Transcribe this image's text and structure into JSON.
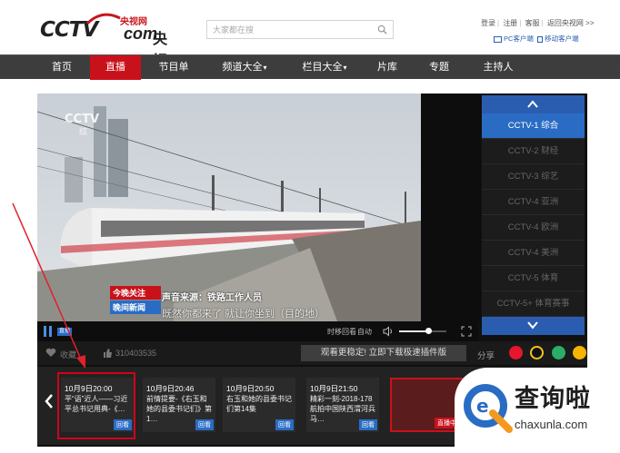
{
  "header": {
    "logo": {
      "brand": "CCTV",
      "small_cn": "央视网",
      "com": "com",
      "cn": "央视"
    },
    "search": {
      "placeholder": "大家都在搜"
    },
    "top_links": [
      "登录",
      "注册",
      "客服",
      "返回央视网 >>"
    ],
    "sub_links": [
      "PC客户端",
      "移动客户端"
    ]
  },
  "nav": {
    "items": [
      {
        "label": "首页",
        "active": false,
        "dropdown": false
      },
      {
        "label": "直播",
        "active": true,
        "dropdown": false
      },
      {
        "label": "节目单",
        "active": false,
        "dropdown": false
      },
      {
        "label": "频道大全",
        "active": false,
        "dropdown": true
      },
      {
        "label": "栏目大全",
        "active": false,
        "dropdown": true
      },
      {
        "label": "片库",
        "active": false,
        "dropdown": false
      },
      {
        "label": "专题",
        "active": false,
        "dropdown": false
      },
      {
        "label": "主持人",
        "active": false,
        "dropdown": false
      }
    ]
  },
  "player": {
    "overlay": {
      "channel_logo": "CCTV",
      "channel_sub": "综",
      "hd": "高清",
      "subtitle_speaker": "声音来源：铁路工作人员",
      "subtitle_line": "既然你都来了 就让你坐到（目的地）",
      "show_badge_top": "今晚关注",
      "show_badge_bottom": "晚间新闻"
    },
    "controls": {
      "live_tag": "直播",
      "timeshift": "时移回看",
      "auto": "自动",
      "volume_level": 0.62
    }
  },
  "channels": {
    "items": [
      {
        "label": "CCTV-1 综合",
        "active": true
      },
      {
        "label": "CCTV-2 财经",
        "active": false
      },
      {
        "label": "CCTV-3 综艺",
        "active": false
      },
      {
        "label": "CCTV-4 亚洲",
        "active": false
      },
      {
        "label": "CCTV-4 欧洲",
        "active": false
      },
      {
        "label": "CCTV-4 美洲",
        "active": false
      },
      {
        "label": "CCTV-5 体育",
        "active": false
      },
      {
        "label": "CCTV-5+ 体育赛事",
        "active": false
      }
    ]
  },
  "social": {
    "favorite": "收藏",
    "likes": "310403535",
    "tip": "观看更稳定! 立即下载极速插件版",
    "share": "分享"
  },
  "programs": [
    {
      "time": "10月9日20:00",
      "title": "平“语”近人——习近平总书记用典-《…",
      "badge": "回看"
    },
    {
      "time": "10月9日20:46",
      "title": "前情提要-《右玉和她的县委书记们》第1…",
      "badge": "回看"
    },
    {
      "time": "10月9日20:50",
      "title": "右玉和她的县委书记们第14集",
      "badge": "回看"
    },
    {
      "time": "10月9日21:50",
      "title": "精彩一刻-2018-178航拍中国陕西渭河兵马…",
      "badge": "回看"
    },
    {
      "time": "",
      "title": "",
      "badge": "直播中"
    }
  ],
  "watermark": {
    "cn": "查询啦",
    "en": "chaxunla.com"
  },
  "colors": {
    "accent_red": "#c9111b",
    "accent_blue": "#2a6cc4",
    "nav_bg": "#3d3d3d"
  }
}
